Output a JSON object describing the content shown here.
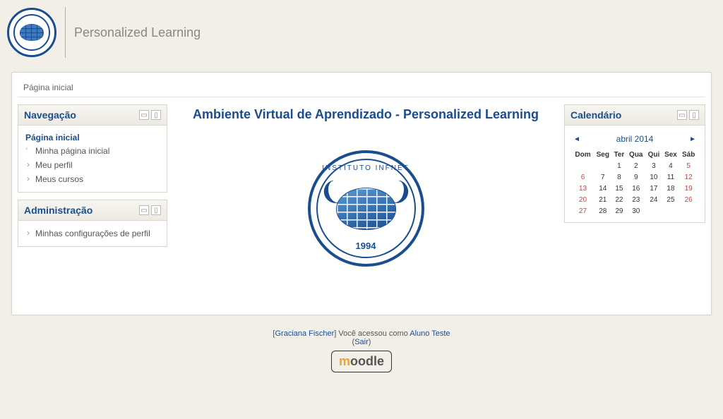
{
  "header": {
    "brand": "Personalized Learning",
    "logo_year": "1994"
  },
  "breadcrumb": {
    "home": "Página inicial"
  },
  "nav_block": {
    "title": "Navegação",
    "root": "Página inicial",
    "items": [
      "Minha página inicial",
      "Meu perfil",
      "Meus cursos"
    ]
  },
  "admin_block": {
    "title": "Administração",
    "items": [
      "Minhas configurações de perfil"
    ]
  },
  "main": {
    "title": "Ambiente Virtual de Aprendizado - Personalized Learning",
    "logo_top": "INSTITUTO INFNET",
    "logo_year": "1994"
  },
  "calendar": {
    "title": "Calendário",
    "month_label": "abril 2014",
    "prev": "◄",
    "next": "►",
    "day_headers": [
      "Dom",
      "Seg",
      "Ter",
      "Qua",
      "Qui",
      "Sex",
      "Sáb"
    ],
    "weeks": [
      [
        "",
        "",
        "1",
        "2",
        "3",
        "4",
        "5"
      ],
      [
        "6",
        "7",
        "8",
        "9",
        "10",
        "11",
        "12"
      ],
      [
        "13",
        "14",
        "15",
        "16",
        "17",
        "18",
        "19"
      ],
      [
        "20",
        "21",
        "22",
        "23",
        "24",
        "25",
        "26"
      ],
      [
        "27",
        "28",
        "29",
        "30",
        "",
        "",
        ""
      ]
    ]
  },
  "footer": {
    "name": "Graciana Fischer",
    "text1": "] Você acessou como ",
    "as_user": "Aluno Teste",
    "logout": "Sair",
    "moodle": "moodle"
  }
}
